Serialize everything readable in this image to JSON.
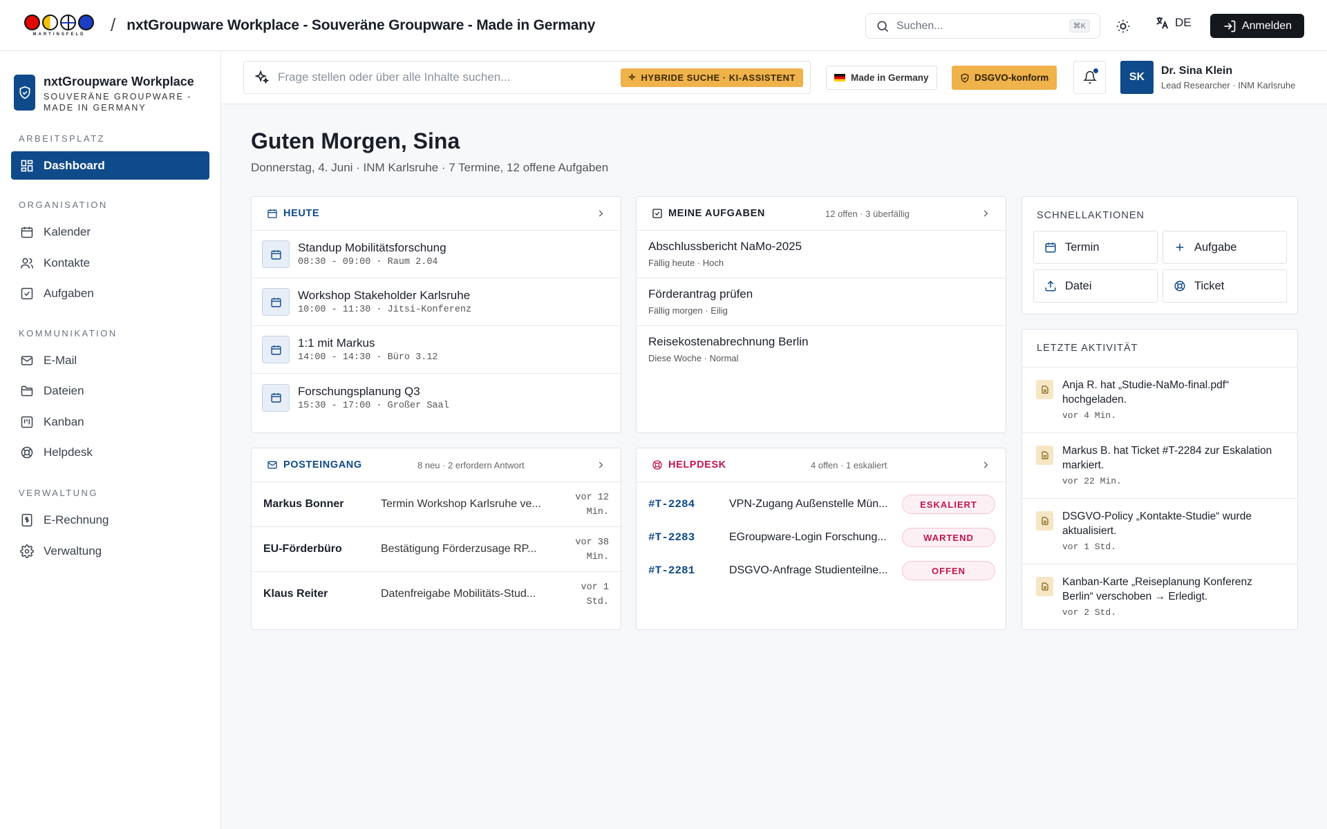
{
  "topbar": {
    "logo_text": "MARTINSFELD",
    "separator": "/",
    "title": "nxtGroupware Workplace - Souveräne Groupware - Made in Germany",
    "search_placeholder": "Suchen...",
    "search_shortcut": "⌘K",
    "language": "DE",
    "login_label": "Anmelden"
  },
  "sidebar": {
    "brand_name": "nxtGroupware Workplace",
    "brand_sub_1": "SOUVERÄNE GROUPWARE -",
    "brand_sub_2": "MADE IN GERMANY",
    "sections": {
      "arbeitsplatz": "ARBEITSPLATZ",
      "organisation": "ORGANISATION",
      "kommunikation": "KOMMUNIKATION",
      "verwaltung": "VERWALTUNG"
    },
    "items": {
      "dashboard": "Dashboard",
      "kalender": "Kalender",
      "kontakte": "Kontakte",
      "aufgaben": "Aufgaben",
      "email": "E-Mail",
      "dateien": "Dateien",
      "kanban": "Kanban",
      "helpdesk": "Helpdesk",
      "erechnung": "E-Rechnung",
      "verwaltung": "Verwaltung"
    }
  },
  "header": {
    "ask_placeholder": "Frage stellen oder über alle Inhalte suchen...",
    "hybrid_badge": "HYBRIDE SUCHE · KI-ASSISTENT",
    "made_in_germany": "Made in Germany",
    "dsgvo": "DSGVO-konform",
    "avatar_initials": "SK",
    "user_name": "Dr. Sina Klein",
    "user_role": "Lead Researcher · INM Karlsruhe"
  },
  "greeting": {
    "title": "Guten Morgen, Sina",
    "subline": "Donnerstag, 4. Juni · INM Karlsruhe · 7 Termine, 12 offene Aufgaben"
  },
  "today": {
    "title": "HEUTE",
    "events": [
      {
        "title": "Standup Mobilitätsforschung",
        "time": "08:30 - 09:00 · Raum 2.04"
      },
      {
        "title": "Workshop Stakeholder Karlsruhe",
        "time": "10:00 - 11:30 · Jitsi-Konferenz"
      },
      {
        "title": "1:1 mit Markus",
        "time": "14:00 - 14:30 · Büro 3.12"
      },
      {
        "title": "Forschungsplanung Q3",
        "time": "15:30 - 17:00 · Großer Saal"
      }
    ]
  },
  "tasks": {
    "title": "MEINE AUFGABEN",
    "meta": "12 offen · 3 überfällig",
    "items": [
      {
        "title": "Abschlussbericht NaMo-2025",
        "meta": "Fällig heute · Hoch"
      },
      {
        "title": "Förderantrag prüfen",
        "meta": "Fällig morgen · Eilig"
      },
      {
        "title": "Reisekostenabrechnung Berlin",
        "meta": "Diese Woche · Normal"
      }
    ]
  },
  "quick": {
    "title": "SCHNELLAKTIONEN",
    "termin": "Termin",
    "aufgabe": "Aufgabe",
    "datei": "Datei",
    "ticket": "Ticket"
  },
  "inbox": {
    "title": "POSTEINGANG",
    "meta": "8 neu · 2 erfordern Antwort",
    "items": [
      {
        "from": "Markus Bonner",
        "subject": "Termin Workshop Karlsruhe ve...",
        "time_1": "vor 12",
        "time_2": "Min."
      },
      {
        "from": "EU-Förderbüro",
        "subject": "Bestätigung Förderzusage RP...",
        "time_1": "vor 38",
        "time_2": "Min."
      },
      {
        "from": "Klaus Reiter",
        "subject": "Datenfreigabe Mobilitäts-Stud...",
        "time_1": "vor 1",
        "time_2": "Std."
      }
    ]
  },
  "helpdesk": {
    "title": "HELPDESK",
    "meta": "4 offen · 1 eskaliert",
    "items": [
      {
        "id": "#T-2284",
        "title": "VPN-Zugang Außenstelle Mün...",
        "status": "ESKALIERT"
      },
      {
        "id": "#T-2283",
        "title": "EGroupware-Login Forschung...",
        "status": "WARTEND"
      },
      {
        "id": "#T-2281",
        "title": "DSGVO-Anfrage Studienteilne...",
        "status": "OFFEN"
      }
    ]
  },
  "activity": {
    "title": "LETZTE AKTIVITÄT",
    "items": [
      {
        "text": "Anja R. hat „Studie-NaMo-final.pdf“ hochgeladen.",
        "time": "vor 4 Min."
      },
      {
        "text": "Markus B. hat Ticket #T-2284 zur Eskalation markiert.",
        "time": "vor 22 Min."
      },
      {
        "text": "DSGVO-Policy „Kontakte-Studie“ wurde aktualisiert.",
        "time": "vor 1 Std."
      },
      {
        "text": "Kanban-Karte „Reiseplanung Konferenz Berlin“ verschoben → Erledigt.",
        "time": "vor 2 Std."
      }
    ]
  },
  "colors": {
    "primary": "#0f4a8a",
    "accent": "#f0b24a",
    "danger": "#c4154b",
    "dark": "#14171c"
  }
}
